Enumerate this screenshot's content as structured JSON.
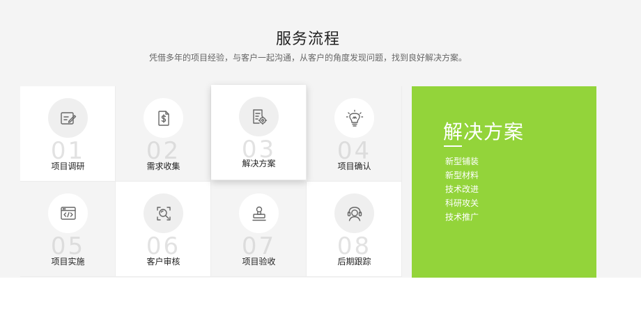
{
  "section": {
    "title": "服务流程",
    "subtitle": "凭借多年的项目经验，与客户一起沟通，从客户的角度发现问题，找到良好解决方案。"
  },
  "steps": [
    {
      "number": "01",
      "label": "项目调研",
      "icon": "edit-note-icon"
    },
    {
      "number": "02",
      "label": "需求收集",
      "icon": "dollar-document-icon"
    },
    {
      "number": "03",
      "label": "解决方案",
      "icon": "document-settings-icon"
    },
    {
      "number": "04",
      "label": "项目确认",
      "icon": "lightbulb-icon"
    },
    {
      "number": "05",
      "label": "项目实施",
      "icon": "code-window-icon"
    },
    {
      "number": "06",
      "label": "客户审核",
      "icon": "magnifier-icon"
    },
    {
      "number": "07",
      "label": "项目验收",
      "icon": "stamp-icon"
    },
    {
      "number": "08",
      "label": "后期跟踪",
      "icon": "headset-user-icon"
    }
  ],
  "active_step": "03",
  "panel": {
    "title": "解决方案",
    "items": [
      "新型铺装",
      "新型材料",
      "技术改进",
      "科研攻关",
      "技术推广"
    ]
  },
  "colors": {
    "accent": "#93d43a",
    "background": "#f4f4f4",
    "icon_stroke": "#666666"
  }
}
